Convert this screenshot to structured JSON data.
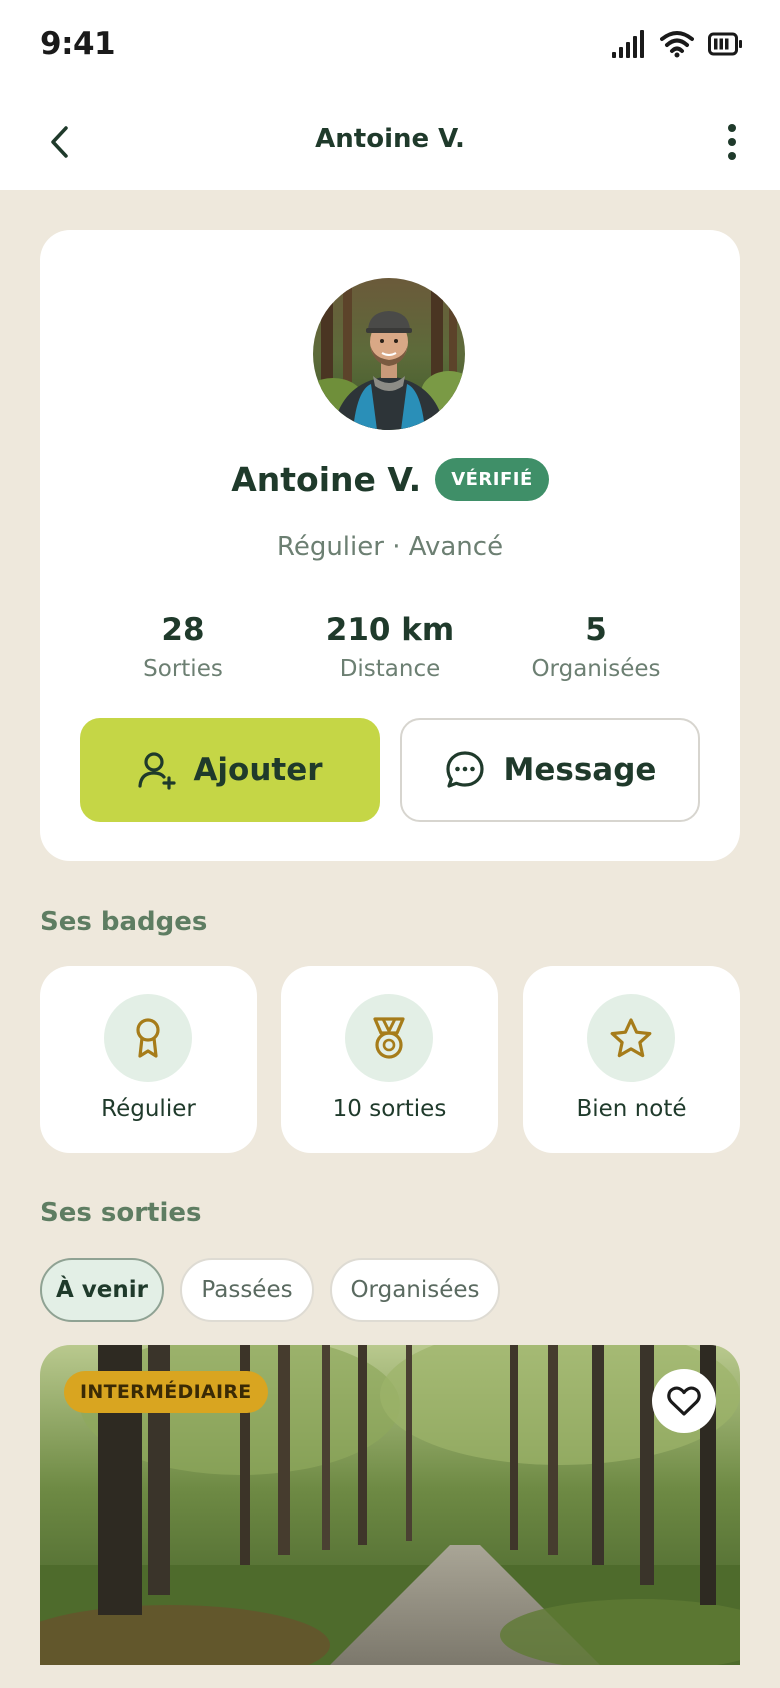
{
  "status_bar": {
    "time": "9:41"
  },
  "nav": {
    "title": "Antoine V."
  },
  "profile": {
    "name": "Antoine V.",
    "verified_label": "VÉRIFIÉ",
    "meta": "Régulier · Avancé",
    "stats": [
      {
        "value": "28",
        "label": "Sorties"
      },
      {
        "value": "210 km",
        "label": "Distance"
      },
      {
        "value": "5",
        "label": "Organisées"
      }
    ],
    "add_label": "Ajouter",
    "message_label": "Message"
  },
  "badges": {
    "title": "Ses badges",
    "items": [
      {
        "label": "Régulier",
        "icon": "ribbon-icon"
      },
      {
        "label": "10 sorties",
        "icon": "medal-icon"
      },
      {
        "label": "Bien noté",
        "icon": "star-icon"
      }
    ]
  },
  "outings": {
    "title": "Ses sorties",
    "tabs": [
      "À venir",
      "Passées",
      "Organisées"
    ],
    "active_tab": "À venir",
    "event": {
      "level": "INTERMÉDIAIRE"
    }
  },
  "colors": {
    "accent": "#C5D646",
    "verified": "#3F8F68",
    "level": "#D9A520",
    "background": "#EEE8DC"
  }
}
